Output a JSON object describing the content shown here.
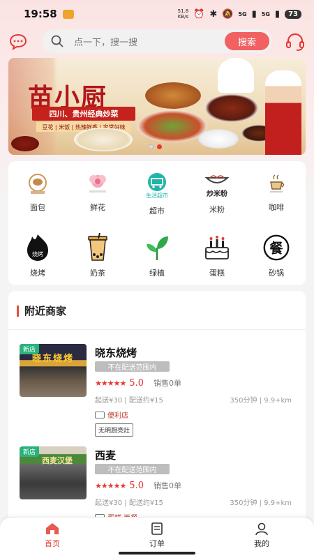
{
  "status_bar": {
    "time": "19:58",
    "speed_value": "51.8",
    "speed_unit": "KB/s",
    "signal1": "5G",
    "signal2": "5G",
    "battery": "73"
  },
  "header": {
    "search_placeholder": "点一下，搜一搜",
    "search_button": "搜索"
  },
  "banner": {
    "title": "苗小厨",
    "subtitle": "四川、贵州经典炒菜",
    "tags": "豆花 | 米饭 | 热辣鲜香 | 家常好味"
  },
  "categories": [
    {
      "label": "面包",
      "icon": "bread-icon"
    },
    {
      "label": "鲜花",
      "icon": "flower-icon"
    },
    {
      "label": "超市",
      "icon": "supermarket-icon"
    },
    {
      "label": "米粉",
      "icon": "rice-noodle-icon"
    },
    {
      "label": "咖啡",
      "icon": "coffee-icon"
    },
    {
      "label": "烧烤",
      "icon": "bbq-icon"
    },
    {
      "label": "奶茶",
      "icon": "milk-tea-icon"
    },
    {
      "label": "绿植",
      "icon": "plant-icon"
    },
    {
      "label": "蛋糕",
      "icon": "cake-icon"
    },
    {
      "label": "砂锅",
      "icon": "clay-pot-icon"
    }
  ],
  "category_icon_text": {
    "supermarket": "生活超市",
    "rice_noodle": "炒米粉",
    "bbq": "烧烤",
    "clay_pot": "餐"
  },
  "nearby": {
    "title": "附近商家",
    "shops": [
      {
        "badge": "新店",
        "name": "晓东烧烤",
        "range": "不在配送范围内",
        "stars": "★★★★★",
        "score": "5.0",
        "sales": "销售0单",
        "delivery": "起送¥30 | 配送约¥15",
        "distance": "350分钟 | 9.9+km",
        "service": "便利店",
        "tag": "无明厨亮灶",
        "sign_text": "晓东烧烤"
      },
      {
        "badge": "新店",
        "name": "西麦",
        "range": "不在配送范围内",
        "stars": "★★★★★",
        "score": "5.0",
        "sales": "销售0单",
        "delivery": "起送¥30 | 配送约¥15",
        "distance": "350分钟 | 9.9+km",
        "service": "蛋糕 西餐",
        "sign_text": "西麦汉堡"
      }
    ]
  },
  "bottom_nav": {
    "home": "首页",
    "orders": "订单",
    "mine": "我的"
  },
  "colors": {
    "accent": "#e53935",
    "search_button": "#f16161",
    "new_badge": "#29b27c"
  }
}
